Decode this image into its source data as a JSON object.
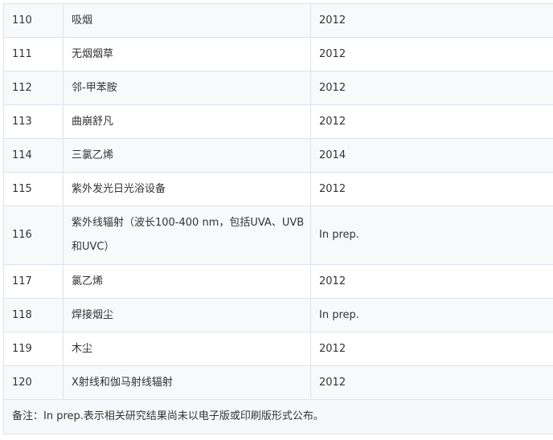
{
  "table": {
    "rows": [
      {
        "num": "110",
        "name": "吸烟",
        "year": "2012"
      },
      {
        "num": "111",
        "name": "无烟烟草",
        "year": "2012"
      },
      {
        "num": "112",
        "name": "邻-甲苯胺",
        "year": "2012"
      },
      {
        "num": "113",
        "name": "曲崩舒凡",
        "year": "2012"
      },
      {
        "num": "114",
        "name": "三氯乙烯",
        "year": "2014"
      },
      {
        "num": "115",
        "name": "紫外发光日光浴设备",
        "year": "2012"
      },
      {
        "num": "116",
        "name": "紫外线辐射（波长100-400 nm，包括UVA、UVB和UVC）",
        "year": "In prep."
      },
      {
        "num": "117",
        "name": "氯乙烯",
        "year": "2012"
      },
      {
        "num": "118",
        "name": "焊接烟尘",
        "year": "In prep."
      },
      {
        "num": "119",
        "name": "木尘",
        "year": "2012"
      },
      {
        "num": "120",
        "name": "X射线和伽马射线辐射",
        "year": "2012"
      }
    ],
    "note": "备注：In prep.表示相关研究结果尚未以电子版或印刷版形式公布。"
  }
}
